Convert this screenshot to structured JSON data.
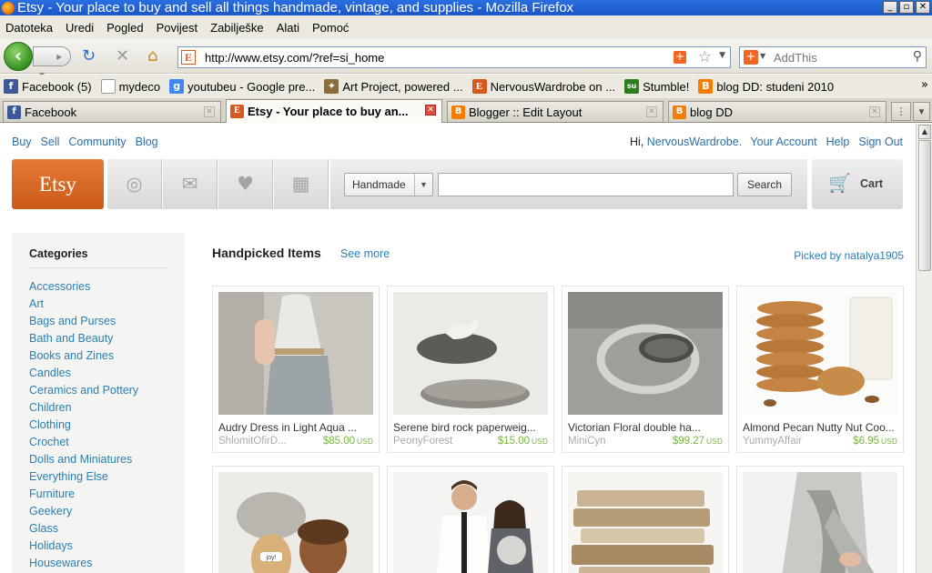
{
  "window": {
    "title": "Etsy - Your place to buy and sell all things handmade, vintage, and supplies - Mozilla Firefox",
    "buttons": [
      "_",
      "▫",
      "✕"
    ]
  },
  "menu": [
    "Datoteka",
    "Uredi",
    "Pogled",
    "Povijest",
    "Zabilješke",
    "Alati",
    "Pomoć"
  ],
  "nav": {
    "url": "http://www.etsy.com/?ref=si_home",
    "search_placeholder": "AddThis"
  },
  "bookmarks": [
    {
      "label": "Facebook (5)",
      "icon": "facebook-icon",
      "color": "#3b5998",
      "glyph": "f"
    },
    {
      "label": "mydeco",
      "icon": "page-icon",
      "color": "#ffffff",
      "glyph": ""
    },
    {
      "label": "youtubeu - Google pre...",
      "icon": "google-icon",
      "color": "#4285f4",
      "glyph": "g"
    },
    {
      "label": "Art Project, powered ...",
      "icon": "art-project-icon",
      "color": "#8a6d3b",
      "glyph": "✦"
    },
    {
      "label": "NervousWardrobe on ...",
      "icon": "etsy-icon",
      "color": "#d9581d",
      "glyph": "E"
    },
    {
      "label": "Stumble!",
      "icon": "stumbleupon-icon",
      "color": "#2d7c1e",
      "glyph": "su"
    },
    {
      "label": "blog DD: studeni 2010",
      "icon": "blogger-icon",
      "color": "#f57d00",
      "glyph": "B"
    }
  ],
  "tabs": [
    {
      "label": "Facebook",
      "icon": "facebook-icon",
      "color": "#3b5998",
      "glyph": "f",
      "active": false
    },
    {
      "label": "Etsy - Your place to buy an...",
      "icon": "etsy-icon",
      "color": "#d9581d",
      "glyph": "E",
      "active": true
    },
    {
      "label": "Blogger :: Edit Layout",
      "icon": "blogger-icon",
      "color": "#f57d00",
      "glyph": "B",
      "active": false
    },
    {
      "label": "blog DD",
      "icon": "blogger-icon",
      "color": "#f57d00",
      "glyph": "B",
      "active": false
    }
  ],
  "etsy": {
    "nav_left": [
      "Buy",
      "Sell",
      "Community",
      "Blog"
    ],
    "greeting": "Hi,",
    "username": "NervousWardrobe.",
    "nav_right": [
      "Your Account",
      "Help",
      "Sign Out"
    ],
    "logo": "Etsy",
    "category_select": "Handmade",
    "search_button": "Search",
    "cart": "Cart",
    "categories_title": "Categories",
    "categories": [
      "Accessories",
      "Art",
      "Bags and Purses",
      "Bath and Beauty",
      "Books and Zines",
      "Candles",
      "Ceramics and Pottery",
      "Children",
      "Clothing",
      "Crochet",
      "Dolls and Miniatures",
      "Everything Else",
      "Furniture",
      "Geekery",
      "Glass",
      "Holidays",
      "Housewares"
    ],
    "handpicked_title": "Handpicked Items",
    "see_more": "See more",
    "picked_by": "Picked by",
    "curator": "natalya1905",
    "currency": "USD",
    "items": [
      {
        "name": "Audry Dress in Light Aqua ...",
        "shop": "ShlomitOfirD...",
        "price": "$85.00"
      },
      {
        "name": "Serene bird rock paperweig...",
        "shop": "PeonyForest",
        "price": "$15.00"
      },
      {
        "name": "Victorian Floral double ha...",
        "shop": "MiniCyn",
        "price": "$99.27"
      },
      {
        "name": "Almond Pecan Nutty Nut Coo...",
        "shop": "YummyAffair",
        "price": "$6.95"
      },
      {
        "name": "",
        "shop": "",
        "price": ""
      },
      {
        "name": "",
        "shop": "",
        "price": ""
      },
      {
        "name": "",
        "shop": "",
        "price": ""
      },
      {
        "name": "",
        "shop": "",
        "price": ""
      }
    ]
  }
}
